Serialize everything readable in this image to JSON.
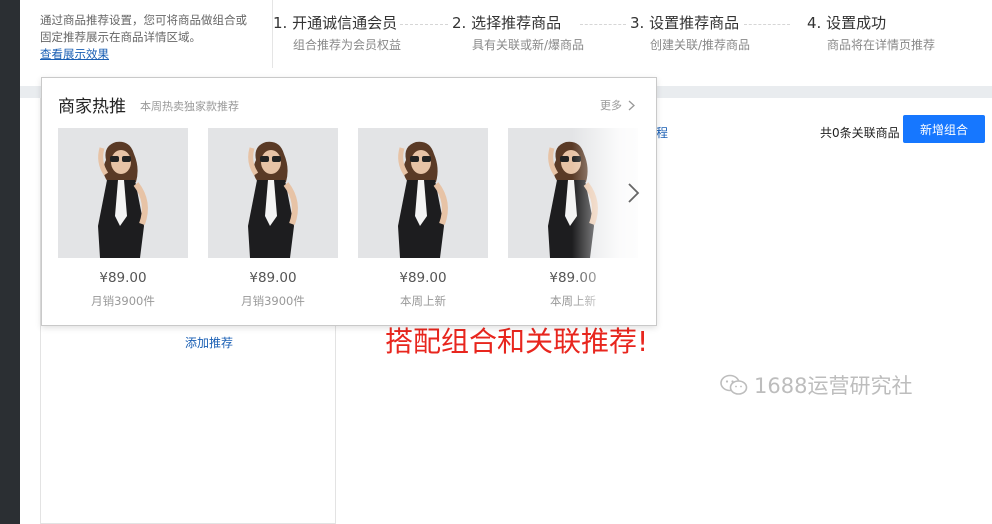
{
  "intro": {
    "text": "通过商品推荐设置，您可将商品做组合或固定推荐展示在商品详情区域。",
    "link": "查看展示效果"
  },
  "steps": [
    {
      "title": "1. 开通诚信通会员",
      "subtitle": "组合推荐为会员权益"
    },
    {
      "title": "2. 选择推荐商品",
      "subtitle": "具有关联或新/爆商品"
    },
    {
      "title": "3. 设置推荐商品",
      "subtitle": "创建关联/推荐商品"
    },
    {
      "title": "4. 设置成功",
      "subtitle": "商品将在详情页推荐"
    }
  ],
  "main": {
    "tutorial_link": "用教程",
    "count_text": "共0条关联商品",
    "add_button": "新增组合",
    "add_recommend": "添加推荐"
  },
  "popup": {
    "title": "商家热推",
    "subtitle": "本周热卖独家款推荐",
    "more": "更多",
    "products": [
      {
        "price": "¥89.00",
        "meta": "月销3900件"
      },
      {
        "price": "¥89.00",
        "meta": "月销3900件"
      },
      {
        "price": "¥89.00",
        "meta": "本周上新"
      },
      {
        "price": "¥89.00",
        "meta": "本周上新"
      }
    ]
  },
  "caption": "搭配组合和关联推荐!",
  "watermark": "1688运营研究社",
  "colors": {
    "accent": "#1677ff",
    "link": "#1a5fb4",
    "caption": "#e8261e"
  }
}
